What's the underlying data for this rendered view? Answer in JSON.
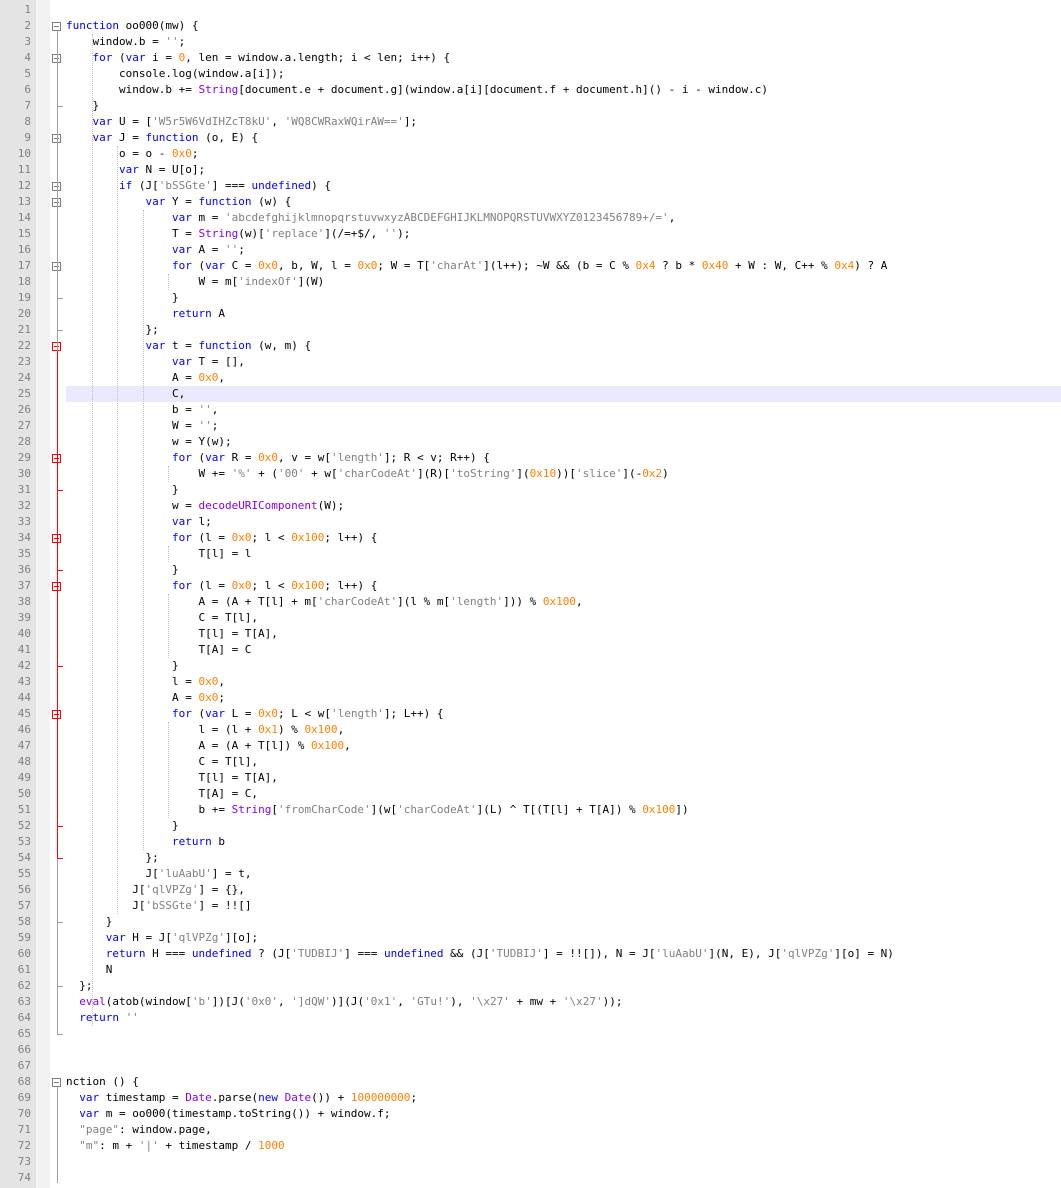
{
  "editor": {
    "lines": [
      {
        "n": "1",
        "t": ""
      },
      {
        "n": "2",
        "t": "function oo000(mw) {"
      },
      {
        "n": "3",
        "t": "    window.b = '';"
      },
      {
        "n": "4",
        "t": "    for (var i = 0, len = window.a.length; i < len; i++) {"
      },
      {
        "n": "5",
        "t": "        console.log(window.a[i]);"
      },
      {
        "n": "6",
        "t": "        window.b += String[document.e + document.g](window.a[i][document.f + document.h]() - i - window.c)"
      },
      {
        "n": "7",
        "t": "    }"
      },
      {
        "n": "8",
        "t": "    var U = ['W5r5W6VdIHZcT8kU', 'WQ8CWRaxWQirAW=='];"
      },
      {
        "n": "9",
        "t": "    var J = function (o, E) {"
      },
      {
        "n": "10",
        "t": "        o = o - 0x0;"
      },
      {
        "n": "11",
        "t": "        var N = U[o];"
      },
      {
        "n": "12",
        "t": "        if (J['bSSGte'] === undefined) {"
      },
      {
        "n": "13",
        "t": "            var Y = function (w) {"
      },
      {
        "n": "14",
        "t": "                var m = 'abcdefghijklmnopqrstuvwxyzABCDEFGHIJKLMNOPQRSTUVWXYZ0123456789+/=',"
      },
      {
        "n": "15",
        "t": "                T = String(w)['replace'](/=+$/, '');"
      },
      {
        "n": "16",
        "t": "                var A = '';"
      },
      {
        "n": "17",
        "t": "                for (var C = 0x0, b, W, l = 0x0; W = T['charAt'](l++); ~W && (b = C % 0x4 ? b * 0x40 + W : W, C++ % 0x4) ? A"
      },
      {
        "n": "18",
        "t": "                    W = m['indexOf'](W)"
      },
      {
        "n": "19",
        "t": "                }"
      },
      {
        "n": "20",
        "t": "                return A"
      },
      {
        "n": "21",
        "t": "            };"
      },
      {
        "n": "22",
        "t": "            var t = function (w, m) {"
      },
      {
        "n": "23",
        "t": "                var T = [],"
      },
      {
        "n": "24",
        "t": "                A = 0x0,"
      },
      {
        "n": "25",
        "t": "                C,"
      },
      {
        "n": "26",
        "t": "                b = '',"
      },
      {
        "n": "27",
        "t": "                W = '';"
      },
      {
        "n": "28",
        "t": "                w = Y(w);"
      },
      {
        "n": "29",
        "t": "                for (var R = 0x0, v = w['length']; R < v; R++) {"
      },
      {
        "n": "30",
        "t": "                    W += '%' + ('00' + w['charCodeAt'](R)['toString'](0x10))['slice'](-0x2)"
      },
      {
        "n": "31",
        "t": "                }"
      },
      {
        "n": "32",
        "t": "                w = decodeURIComponent(W);"
      },
      {
        "n": "33",
        "t": "                var l;"
      },
      {
        "n": "34",
        "t": "                for (l = 0x0; l < 0x100; l++) {"
      },
      {
        "n": "35",
        "t": "                    T[l] = l"
      },
      {
        "n": "36",
        "t": "                }"
      },
      {
        "n": "37",
        "t": "                for (l = 0x0; l < 0x100; l++) {"
      },
      {
        "n": "38",
        "t": "                    A = (A + T[l] + m['charCodeAt'](l % m['length'])) % 0x100,"
      },
      {
        "n": "39",
        "t": "                    C = T[l],"
      },
      {
        "n": "40",
        "t": "                    T[l] = T[A],"
      },
      {
        "n": "41",
        "t": "                    T[A] = C"
      },
      {
        "n": "42",
        "t": "                }"
      },
      {
        "n": "43",
        "t": "                l = 0x0,"
      },
      {
        "n": "44",
        "t": "                A = 0x0;"
      },
      {
        "n": "45",
        "t": "                for (var L = 0x0; L < w['length']; L++) {"
      },
      {
        "n": "46",
        "t": "                    l = (l + 0x1) % 0x100,"
      },
      {
        "n": "47",
        "t": "                    A = (A + T[l]) % 0x100,"
      },
      {
        "n": "48",
        "t": "                    C = T[l],"
      },
      {
        "n": "49",
        "t": "                    T[l] = T[A],"
      },
      {
        "n": "50",
        "t": "                    T[A] = C,"
      },
      {
        "n": "51",
        "t": "                    b += String['fromCharCode'](w['charCodeAt'](L) ^ T[(T[l] + T[A]) % 0x100])"
      },
      {
        "n": "52",
        "t": "                }"
      },
      {
        "n": "53",
        "t": "                return b"
      },
      {
        "n": "54",
        "t": "            };"
      },
      {
        "n": "55",
        "t": "            J['luAabU'] = t,"
      },
      {
        "n": "56",
        "t": "          J['qlVPZg'] = {},"
      },
      {
        "n": "57",
        "t": "          J['bSSGte'] = !![]"
      },
      {
        "n": "58",
        "t": "      }"
      },
      {
        "n": "59",
        "t": "      var H = J['qlVPZg'][o];"
      },
      {
        "n": "60",
        "t": "      return H === undefined ? (J['TUDBIJ'] === undefined && (J['TUDBIJ'] = !![]), N = J['luAabU'](N, E), J['qlVPZg'][o] = N)"
      },
      {
        "n": "61",
        "t": "      N"
      },
      {
        "n": "62",
        "t": "  };"
      },
      {
        "n": "63",
        "t": "  eval(atob(window['b'])[J('0x0', ']dQW')](J('0x1', 'GTu!'), '\\x27' + mw + '\\x27'));"
      },
      {
        "n": "64",
        "t": "  return ''"
      },
      {
        "n": "65",
        "t": ""
      },
      {
        "n": "66",
        "t": ""
      },
      {
        "n": "67",
        "t": ""
      },
      {
        "n": "68",
        "t": "nction () {"
      },
      {
        "n": "69",
        "t": "  var timestamp = Date.parse(new Date()) + 100000000;"
      },
      {
        "n": "70",
        "t": "  var m = oo000(timestamp.toString()) + window.f;"
      },
      {
        "n": "71",
        "t": "  \"page\": window.page,"
      },
      {
        "n": "72",
        "t": "  \"m\": m + '|' + timestamp / 1000"
      },
      {
        "n": "73",
        "t": ""
      },
      {
        "n": "74",
        "t": ""
      }
    ]
  },
  "colors": {
    "keyword": "#0000ff",
    "number": "#ff8000",
    "string": "#808080",
    "operator": "#000080",
    "function": "#8000ff",
    "gutter": "#e4e4e4",
    "current_line": "#e8e8ff",
    "fold_marker_red": "#ff0000"
  }
}
